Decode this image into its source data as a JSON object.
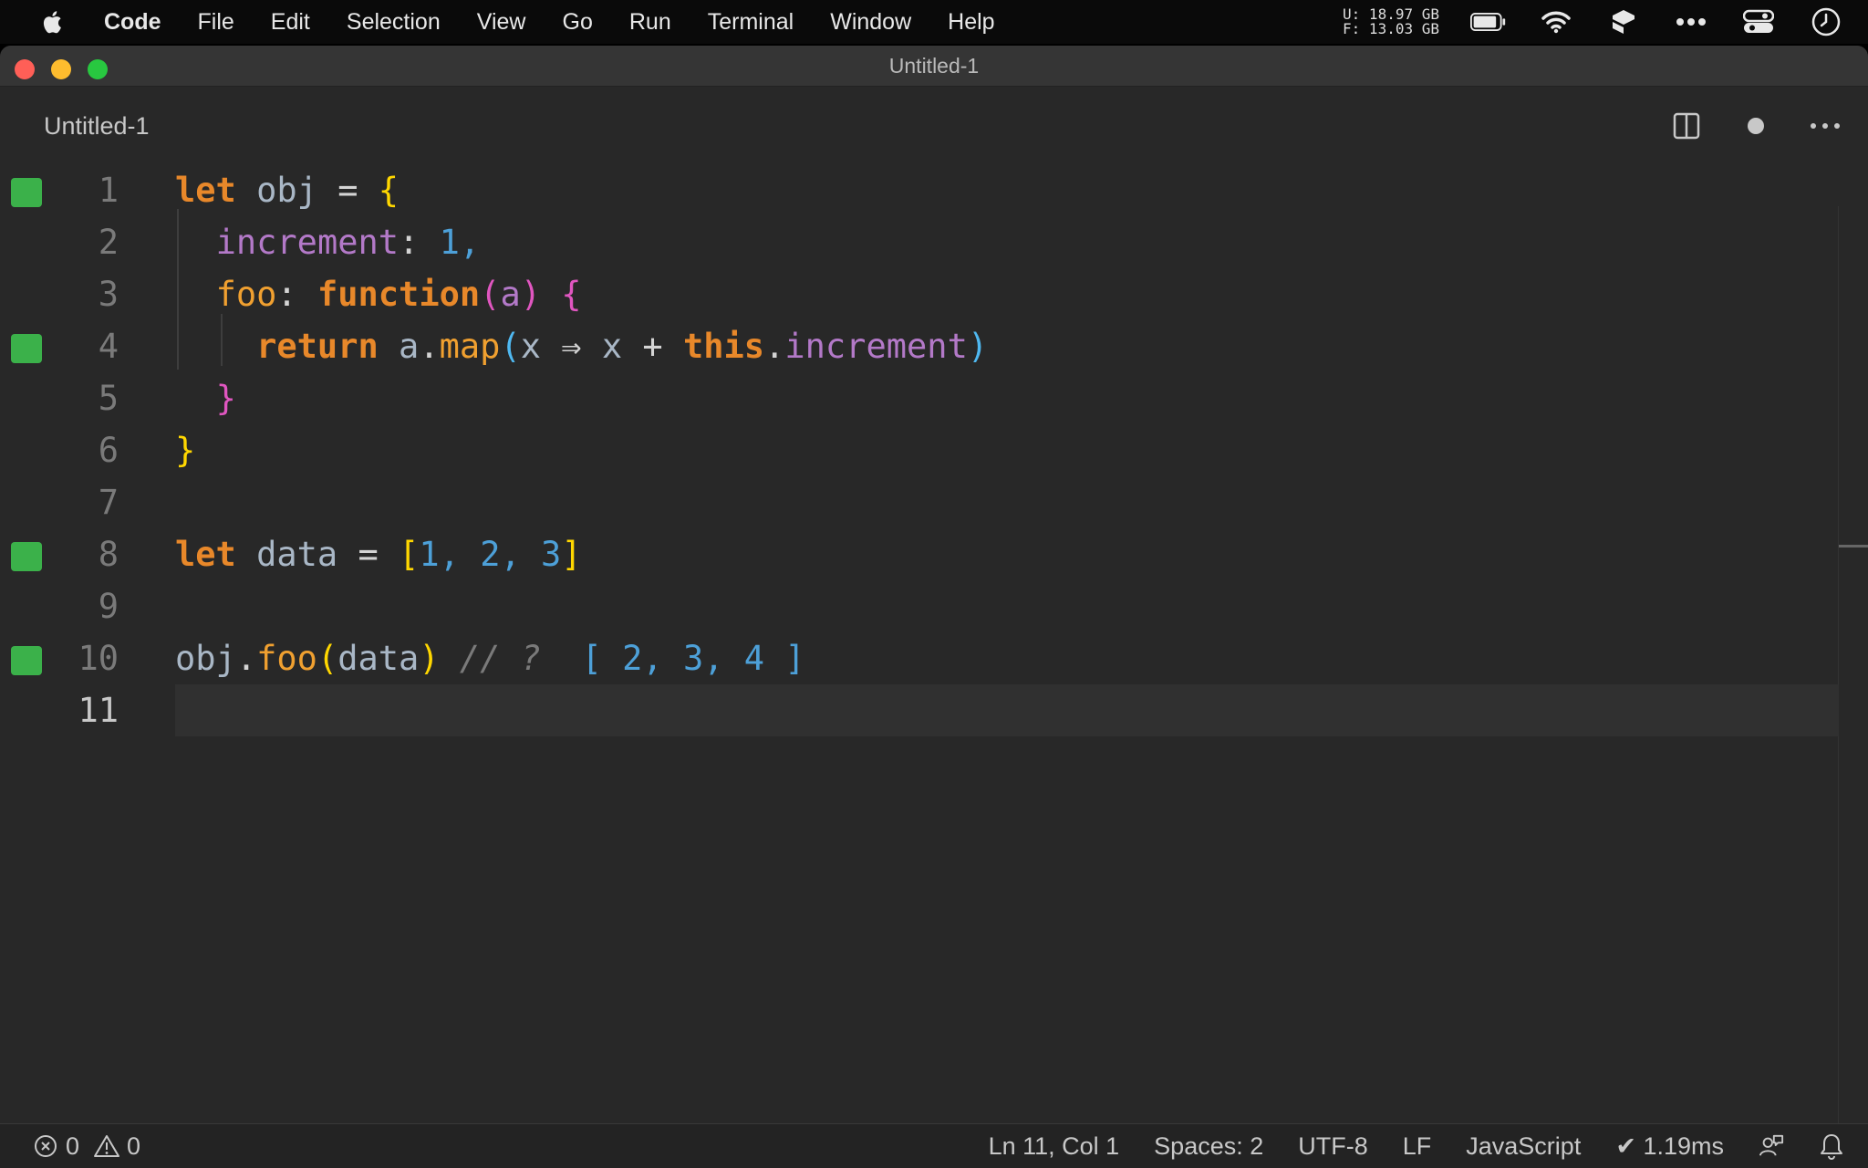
{
  "menubar": {
    "app": "Code",
    "items": [
      "File",
      "Edit",
      "Selection",
      "View",
      "Go",
      "Run",
      "Terminal",
      "Window",
      "Help"
    ],
    "memory_used": "U:  18.97 GB",
    "memory_free": "F:  13.03 GB",
    "icons": [
      "battery-icon",
      "wifi-icon",
      "extension-icon",
      "more-icon",
      "control-center-icon",
      "clock-icon"
    ]
  },
  "window": {
    "title": "Untitled-1"
  },
  "tab": {
    "label": "Untitled-1",
    "actions": [
      "split-editor-icon",
      "unsaved-dot-icon",
      "more-actions-icon"
    ]
  },
  "editor": {
    "line_numbers": [
      "1",
      "2",
      "3",
      "4",
      "5",
      "6",
      "7",
      "8",
      "9",
      "10",
      "11"
    ],
    "gutter_markers": [
      1,
      4,
      8,
      10
    ],
    "current_line": 11,
    "code": {
      "l1": {
        "kw": "let",
        "id": "obj",
        "op": "=",
        "br": "{"
      },
      "l2": {
        "prop": "increment",
        "colon": ":",
        "num": "1",
        "comma": ","
      },
      "l3": {
        "prop": "foo",
        "colon": ":",
        "kw": "function",
        "open": "(",
        "arg": "a",
        "close": ")",
        "br": "{"
      },
      "l4": {
        "kw": "return",
        "obj": "a",
        "dot": ".",
        "fn": "map",
        "open": "(",
        "x": "x",
        "arrow": "⇒",
        "x2": "x",
        "plus": "+",
        "this": "this",
        "dot2": ".",
        "prop": "increment",
        "close": ")"
      },
      "l5": {
        "br": "}"
      },
      "l6": {
        "br": "}"
      },
      "l8": {
        "kw": "let",
        "id": "data",
        "op": "=",
        "open": "[",
        "n1": "1",
        "c1": ",",
        "n2": "2",
        "c2": ",",
        "n3": "3",
        "close": "]"
      },
      "l10": {
        "obj": "obj",
        "dot": ".",
        "fn": "foo",
        "open": "(",
        "arg": "data",
        "close": ")",
        "comment": "// ?",
        "result": "[ 2, 3, 4 ]"
      }
    }
  },
  "statusbar": {
    "errors": "0",
    "warnings": "0",
    "position": "Ln 11, Col 1",
    "spaces": "Spaces: 2",
    "encoding": "UTF-8",
    "eol": "LF",
    "language": "JavaScript",
    "timing": "✔ 1.19ms"
  },
  "colors": {
    "gutter_marker": "#3bb14a",
    "keyword": "#e8882a",
    "property": "#b379c8",
    "number": "#4da0d8",
    "function": "#f0a030"
  }
}
